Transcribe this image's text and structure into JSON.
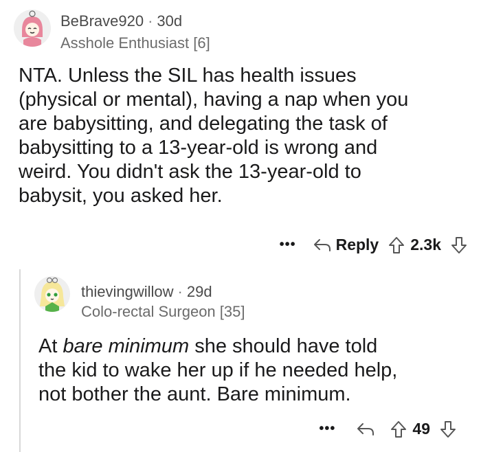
{
  "comments": [
    {
      "username": "BeBrave920",
      "age": "30d",
      "flair": "Asshole Enthusiast [6]",
      "body_lines": [
        "NTA. Unless the SIL has health issues",
        "(physical or mental), having a nap when you",
        "are babysitting, and delegating the task of",
        "babysitting to a 13-year-old is wrong and",
        "weird. You didn't ask the 13-year-old to",
        "babysit, you asked her."
      ],
      "more_label": "•••",
      "reply_label": "Reply",
      "score": "2.3k"
    },
    {
      "username": "thievingwillow",
      "age": "29d",
      "flair": "Colo-rectal Surgeon [35]",
      "body_prefix": "At ",
      "body_emphasis": "bare minimum",
      "body_rest_line1": " she should have told",
      "body_lines": [
        "the kid to wake her up if he needed help,",
        "not bother the aunt. Bare minimum."
      ],
      "more_label": "•••",
      "score": "49"
    }
  ],
  "icons": {
    "reply": "reply-arrow-icon",
    "upvote": "upvote-arrow-icon",
    "downvote": "downvote-arrow-icon",
    "more": "more-options-icon"
  }
}
